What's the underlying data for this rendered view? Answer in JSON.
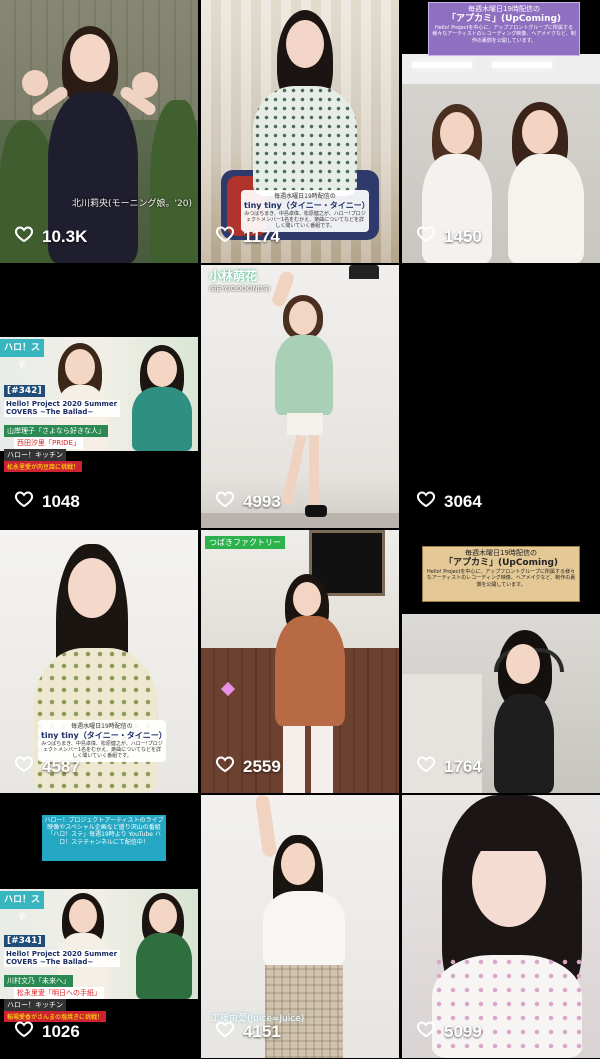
{
  "tiles": [
    {
      "likes": "10.3K",
      "caption": "北川莉央(モーニング娘。'20)"
    },
    {
      "likes": "1174",
      "caption_title": "毎週水曜日19時配信の",
      "caption_main": "tiny tiny（タイニー・タイニー）",
      "caption_sub": "みつばちまき、中島卓偉、松原健之が、ハロー!プロジェクトメンバー1名をむかえ、楽曲についてなどを詳しく聞いていく番組です。"
    },
    {
      "likes": "1450",
      "banner_title": "毎週木曜日19時配信の",
      "banner_main": "「アプカミ」(UpComing)",
      "banner_sub": "Hello! Projectを中心に、アップフロントグループに所属する様々なアーティストのレコーディング映像、ヘアメイクなど、制作の裏側を公開しています。"
    },
    {
      "likes": "1048",
      "logo": "ハロ！ステ",
      "episode": "[#342]",
      "headline": "Hello! Project 2020 Summer COVERS ~The Ballad~",
      "line1": "山岸理子「さよなら好きな人」",
      "line2": "西田汐里「PRIDE」",
      "line3": "ハロー！キッチン",
      "line4": "松永里愛が肉豆腐に挑戦！"
    },
    {
      "likes": "4993",
      "name": "小林萌花",
      "group": "(BEYOOOOONDS)"
    },
    {
      "likes": "3064"
    },
    {
      "likes": "4587",
      "caption_title": "毎週水曜日19時配信の",
      "caption_main": "tiny tiny（タイニー・タイニー）",
      "caption_sub": "みつばちまき、中島卓偉、松原健之が、ハロー!プロジェクトメンバー1名をむかえ、楽曲についてなどを詳しく聞いていく番組です。"
    },
    {
      "likes": "2559",
      "tag": "つばきファクトリー"
    },
    {
      "likes": "1764",
      "banner_title": "毎週木曜日19時配信の",
      "banner_main": "「アプカミ」(UpComing)",
      "banner_sub": "Hello! Projectを中心に、アップフロントグループに所属する様々なアーティストのレコーディング映像、ヘアメイクなど、制作の裏側を公開しています。"
    },
    {
      "likes": "1026",
      "promo": "ハロー！プロジェクトアーティストのライブ映像やスペシャル企画など盛り沢山の番組「ハロ！ステ」毎週19時より YouTube ハロ！ステチャンネルにて配信中！",
      "logo": "ハロ！ステ",
      "episode": "[#341]",
      "headline": "Hello! Project 2020 Summer COVERS ~The Ballad~",
      "line1": "川村文乃「未来へ」",
      "line2": "松永里愛「明日への手紙」",
      "line3": "ハロー！キッチン",
      "line4": "稲場愛香がさんまの塩焼きに挑戦！"
    },
    {
      "likes": "4151",
      "name": "工藤由愛(Juice=Juice)"
    },
    {
      "likes": "5099"
    }
  ]
}
